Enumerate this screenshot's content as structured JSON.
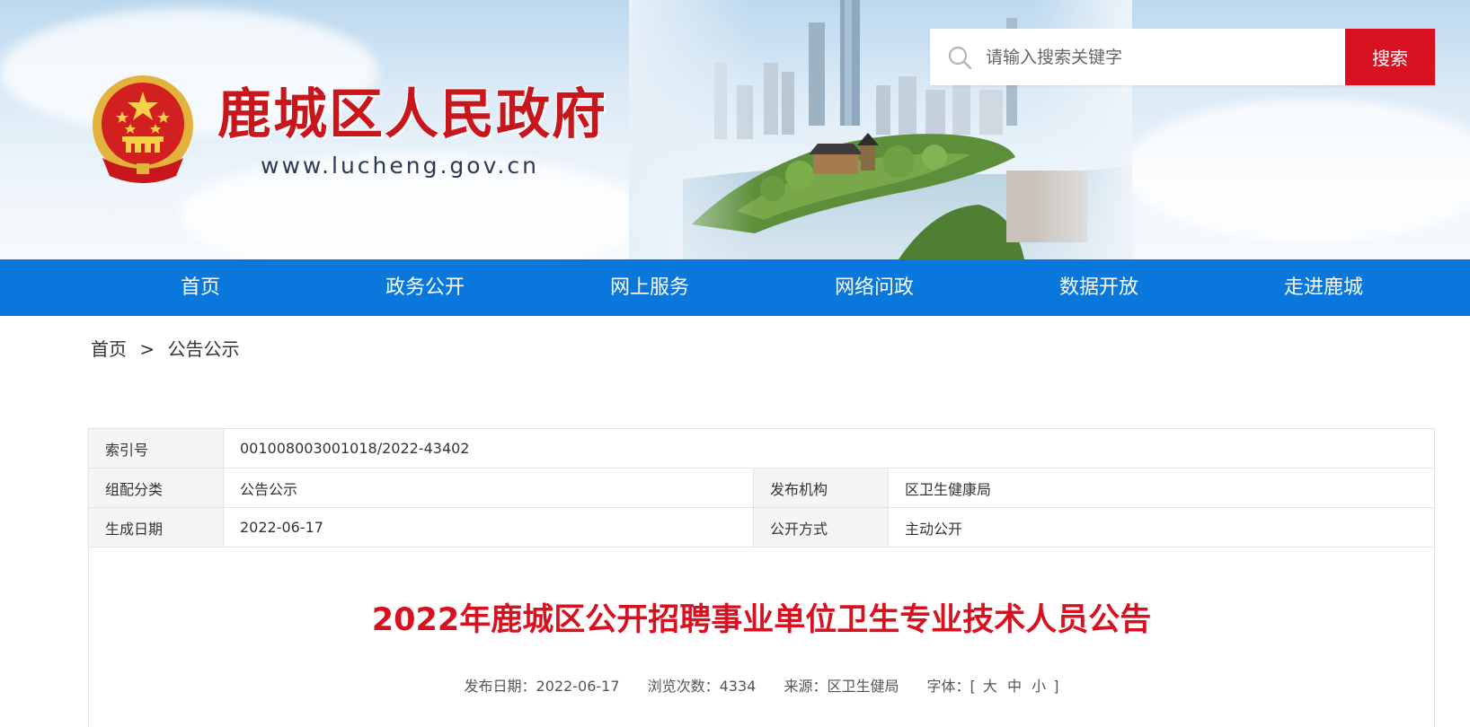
{
  "header": {
    "site_title": "鹿城区人民政府",
    "site_url": "www.lucheng.gov.cn",
    "emblem_icon": "national-emblem-icon",
    "search": {
      "placeholder": "请输入搜索关键字",
      "button_label": "搜索"
    }
  },
  "nav": {
    "items": [
      "首页",
      "政务公开",
      "网上服务",
      "网络问政",
      "数据开放",
      "走进鹿城"
    ]
  },
  "breadcrumb": {
    "home": "首页",
    "separator": ">",
    "current": "公告公示"
  },
  "meta": {
    "index_label": "索引号",
    "index_value": "001008003001018/2022-43402",
    "category_label": "组配分类",
    "category_value": "公告公示",
    "publisher_label": "发布机构",
    "publisher_value": "区卫生健康局",
    "date_label": "生成日期",
    "date_value": "2022-06-17",
    "mode_label": "公开方式",
    "mode_value": "主动公开"
  },
  "article": {
    "title": "2022年鹿城区公开招聘事业单位卫生专业技术人员公告",
    "publish_date": "发布日期：2022-06-17",
    "views": "浏览次数：4334",
    "source": "来源：区卫生健局",
    "font_label": "字体：[",
    "font_large": "大",
    "font_medium": "中",
    "font_small": "小",
    "font_close": "]"
  },
  "colors": {
    "brand_red": "#d7111f",
    "nav_blue": "#0a77dc"
  }
}
